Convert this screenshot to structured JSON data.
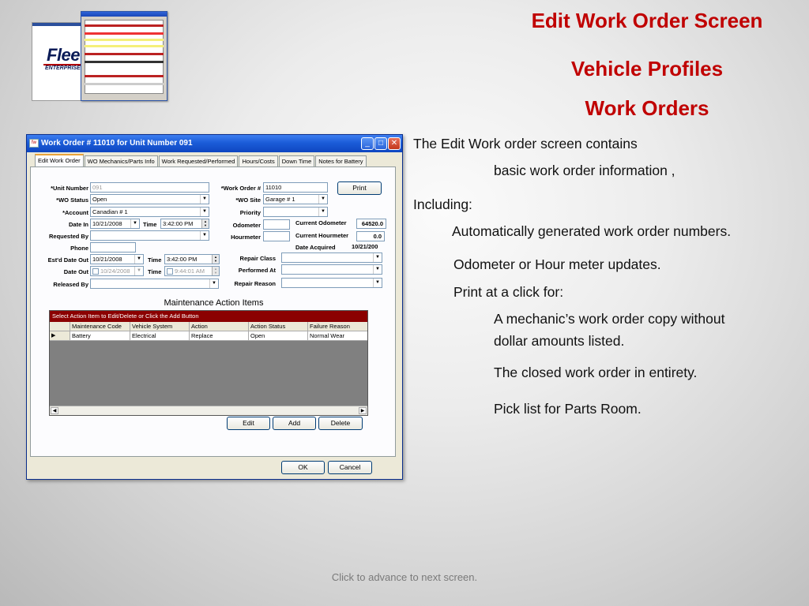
{
  "slide": {
    "title1": "Edit Work Order Screen",
    "title2": "Vehicle Profiles",
    "title3": "Work Orders",
    "bullets": [
      "The Edit Work order screen contains",
      "basic  work order information ,",
      "Including:",
      "Automatically generated work order numbers.",
      "Odometer or Hour meter updates.",
      "Print  at a click for:",
      "A mechanic’s work order copy without",
      "dollar amounts listed.",
      "The closed work order in entirety.",
      "Pick list for Parts Room."
    ],
    "footer": "Click to advance to next screen.",
    "logo_word": "Flee",
    "logo_sub": "ENTERPRISE E",
    "accent_color": "#c00000"
  },
  "window": {
    "title": "Work Order # 11010 for Unit Number 091",
    "icon_name": "app-icon",
    "tabs": [
      "Edit Work Order",
      "WO Mechanics/Parts Info",
      "Work Requested/Performed",
      "Hours/Costs",
      "Down Time",
      "Notes for Battery"
    ],
    "form": {
      "unit_number_label": "*Unit Number",
      "unit_number_value": "091",
      "wo_status_label": "*WO Status",
      "wo_status_value": "Open",
      "account_label": "*Account",
      "account_value": "Canadian # 1",
      "date_in_label": "Date In",
      "date_in_value": "10/21/2008",
      "time_label": "Time",
      "time_in_value": "3:42:00 PM",
      "requested_by_label": "Requested By",
      "requested_by_value": "",
      "phone_label": "Phone",
      "phone_value": "",
      "estd_date_out_label": "Est'd Date Out",
      "estd_date_out_value": "10/21/2008",
      "estd_time_value": "3:42:00 PM",
      "date_out_label": "Date Out",
      "date_out_value": "10/24/2008",
      "time_out_value": "9:44:01 AM",
      "released_by_label": "Released By",
      "released_by_value": "",
      "work_order_label": "*Work Order #",
      "work_order_value": "11010",
      "print_label": "Print",
      "wo_site_label": "*WO Site",
      "wo_site_value": "Garage # 1",
      "priority_label": "Priority",
      "priority_value": "",
      "odometer_label": "Odometer",
      "odometer_value": "",
      "hourmeter_label": "Hourmeter",
      "hourmeter_value": "",
      "current_odometer_label": "Current Odometer",
      "current_odometer_value": "64520.0",
      "current_hourmeter_label": "Current Hourmeter",
      "current_hourmeter_value": "0.0",
      "date_acquired_label": "Date Acquired",
      "date_acquired_value": "10/21/200",
      "repair_class_label": "Repair Class",
      "performed_at_label": "Performed At",
      "repair_reason_label": "Repair Reason"
    },
    "grid": {
      "title": "Maintenance Action Items",
      "header": "Select Action Item to Edit/Delete or Click the Add Button",
      "columns": [
        "Maintenance Code",
        "Vehicle System",
        "Action",
        "Action Status",
        "Failure Reason"
      ],
      "rows": [
        [
          "Battery",
          "Electrical",
          "Replace",
          "Open",
          "Normal Wear"
        ]
      ],
      "row_pointer": "▶"
    },
    "buttons": {
      "edit": "Edit",
      "add": "Add",
      "delete": "Delete",
      "ok": "OK",
      "cancel": "Cancel"
    }
  }
}
